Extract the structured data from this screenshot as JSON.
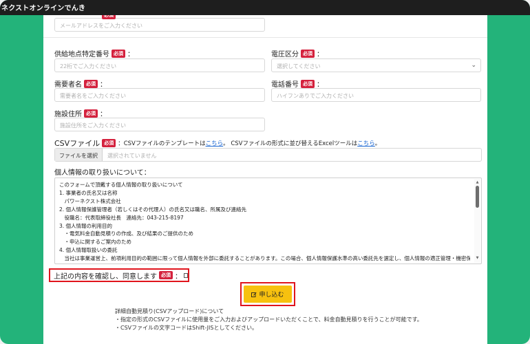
{
  "window": {
    "title": "ネクストオンラインでんき"
  },
  "required_badge": "必須",
  "email": {
    "placeholder": "メールアドレスをご入力ください"
  },
  "supply_point": {
    "label": "供給地点特定番号",
    "placeholder": "22桁でご入力ください"
  },
  "voltage": {
    "label": "電圧区分",
    "placeholder": "選択してください"
  },
  "customer_name": {
    "label": "需要者名",
    "placeholder": "需要者名をご入力ください"
  },
  "phone": {
    "label": "電話番号",
    "placeholder": "ハイフンありでご入力ください"
  },
  "facility_address": {
    "label": "施設住所",
    "placeholder": "施設住所をご入力ください"
  },
  "csv": {
    "label": "CSVファイル",
    "desc_1": "：CSVファイルのテンプレートは",
    "link_1": "こちら",
    "desc_2": "。 CSVファイルの形式に並び替えるExcelツールは",
    "link_2": "こちら",
    "desc_3": "。",
    "choose_button": "ファイルを選択",
    "no_file": "選択されていません"
  },
  "privacy": {
    "title": "個人情報の取り扱いについて：",
    "lines": [
      "このフォームで頂戴する個人情報の取り扱いについて",
      "1. 事業者の氏名又は名称",
      "　パワーネクスト株式会社",
      "2. 個人情報保護管理者（若しくはその代理人）の氏名又は職名、所属及び連絡先",
      "　役職名：代表取締役社長　連絡先：043-215-8197",
      "3. 個人情報の利用目的",
      "　・電気料金自動見積りの作成、及び結果のご提供のため",
      "　・申込に関するご案内のため",
      "4. 個人情報取扱いの委託",
      "　当社は事業運営上、前項利用目的の範囲に限って個人情報を外部に委託することがあります。この場合、個人情報保護水準の高い委託先を選定し、個人情報の適正管理・機密保持について契約を交わし、適切な管理を実施させます。"
    ]
  },
  "consent": {
    "label": "上記の内容を確認し、同意します",
    "colon": "："
  },
  "submit": {
    "label": "申し込む",
    "icon": "edit-icon"
  },
  "notes": {
    "lines": [
      "詳細自動見積り(CSVアップロード)について",
      "・指定の形式のCSVファイルに使用量をご入力およびアップロードいただくことで、料金自動見積りを行うことが可能です。",
      "・CSVファイルの文字コードはShift-JISとしてください。"
    ]
  },
  "colors": {
    "brand_green": "#23b37a",
    "required_red": "#d4213d",
    "highlight_red": "#e0141c",
    "submit_yellow": "#f7c10f",
    "link_blue": "#1a66d2"
  }
}
